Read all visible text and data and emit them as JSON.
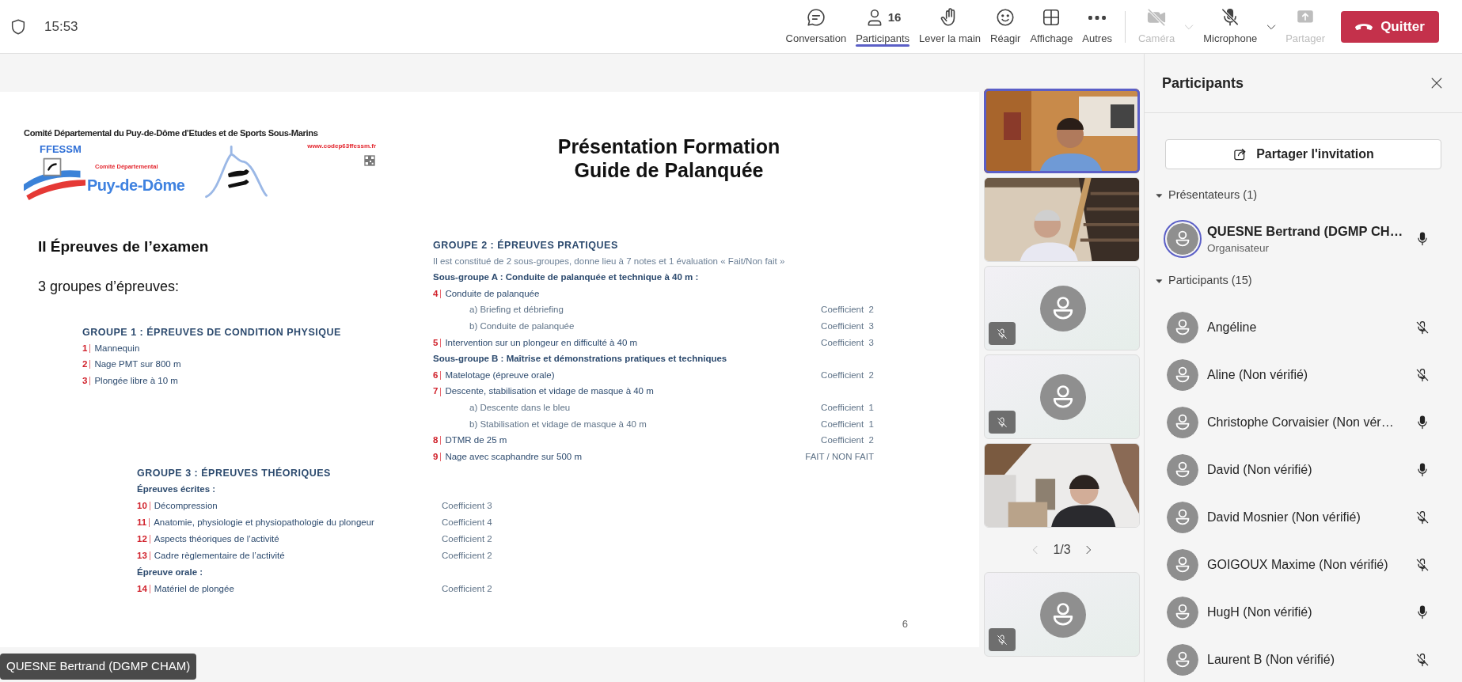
{
  "top_bar": {
    "time": "15:53"
  },
  "toolbar": [
    {
      "kind": "chat",
      "label": "Conversation",
      "selected": false,
      "disabled": false,
      "has_menu": false
    },
    {
      "kind": "people",
      "label": "Participants",
      "count": "16",
      "selected": true,
      "disabled": false,
      "has_menu": false
    },
    {
      "kind": "hand",
      "label": "Lever la main",
      "selected": false,
      "disabled": false,
      "has_menu": false
    },
    {
      "kind": "emoji",
      "label": "Réagir",
      "selected": false,
      "disabled": false,
      "has_menu": false
    },
    {
      "kind": "grid",
      "label": "Affichage",
      "selected": false,
      "disabled": false,
      "has_menu": false
    },
    {
      "kind": "more",
      "label": "Autres",
      "selected": false,
      "disabled": false,
      "has_menu": false
    },
    {
      "kind": "camera",
      "label": "Caméra",
      "selected": false,
      "disabled": true,
      "has_menu": true
    },
    {
      "kind": "mic",
      "label": "Microphone",
      "selected": false,
      "disabled": false,
      "has_menu": true
    },
    {
      "kind": "share",
      "label": "Partager",
      "selected": false,
      "disabled": true,
      "has_menu": false
    }
  ],
  "leave_button": {
    "label": "Quitter"
  },
  "slide": {
    "logo": {
      "header": "Comité Départemental du Puy-de-Dôme d’Etudes et de Sports Sous-Marins",
      "federation": "FFESSM",
      "url": "www.codep63ffessm.fr",
      "committee": "Comité Départemental",
      "department": "Puy-de-Dôme"
    },
    "title_lines": [
      "Présentation Formation",
      "Guide de Palanquée"
    ],
    "heading": "II Épreuves de l’examen",
    "subheading": "3 groupes d’épreuves:",
    "groups": [
      {
        "title": "GROUPE 1 : ÉPREUVES DE CONDITION PHYSIQUE",
        "rows": [
          {
            "kind": "item",
            "number": "1",
            "label": "Mannequin"
          },
          {
            "kind": "item",
            "number": "2",
            "label": "Nage PMT sur 800 m"
          },
          {
            "kind": "item",
            "number": "3",
            "label": "Plongée libre à 10 m"
          }
        ]
      },
      {
        "title": "GROUPE 2 : ÉPREUVES PRATIQUES",
        "rows": [
          {
            "kind": "note",
            "label": "Il est constitué de 2 sous-groupes, donne lieu à 7 notes et 1 évaluation « Fait/Non fait »"
          },
          {
            "kind": "subgroup",
            "label": "Sous-groupe A : Conduite de palanquée et technique à 40 m :"
          },
          {
            "kind": "item",
            "number": "4",
            "label": "Conduite de palanquée"
          },
          {
            "kind": "subitem",
            "label": "a) Briefing et débriefing",
            "coefficient": "Coefficient  2"
          },
          {
            "kind": "subitem",
            "label": "b) Conduite de palanquée",
            "coefficient": "Coefficient  3"
          },
          {
            "kind": "item",
            "number": "5",
            "label": "Intervention sur un plongeur en difficulté à 40 m",
            "coefficient": "Coefficient  3"
          },
          {
            "kind": "subgroup",
            "label": "Sous-groupe B : Maîtrise et démonstrations pratiques et techniques"
          },
          {
            "kind": "item",
            "number": "6",
            "label": "Matelotage (épreuve orale)",
            "coefficient": "Coefficient  2"
          },
          {
            "kind": "item",
            "number": "7",
            "label": "Descente, stabilisation et vidage de masque à 40 m"
          },
          {
            "kind": "subitem",
            "label": "a) Descente dans le bleu",
            "coefficient": "Coefficient  1"
          },
          {
            "kind": "subitem",
            "label": "b) Stabilisation et vidage de masque à 40 m",
            "coefficient": "Coefficient  1"
          },
          {
            "kind": "item",
            "number": "8",
            "label": "DTMR de 25 m",
            "coefficient": "Coefficient  2"
          },
          {
            "kind": "item",
            "number": "9",
            "label": "Nage avec scaphandre sur 500 m",
            "coefficient": "FAIT / NON FAIT"
          }
        ]
      },
      {
        "title": "GROUPE 3 : ÉPREUVES THÉORIQUES",
        "rows": [
          {
            "kind": "subgroup",
            "label": "Épreuves écrites :"
          },
          {
            "kind": "item",
            "number": "10",
            "label": "Décompression",
            "coefficient": "Coefficient 3"
          },
          {
            "kind": "item",
            "number": "11",
            "label": "Anatomie, physiologie et physiopathologie du plongeur",
            "coefficient": "Coefficient 4"
          },
          {
            "kind": "item",
            "number": "12",
            "label": "Aspects théoriques de l’activité",
            "coefficient": "Coefficient 2"
          },
          {
            "kind": "item",
            "number": "13",
            "label": "Cadre règlementaire de l’activité",
            "coefficient": "Coefficient 2"
          },
          {
            "kind": "subgroup",
            "label": "Épreuve orale :"
          },
          {
            "kind": "item",
            "number": "14",
            "label": "Matériel de plongée",
            "coefficient": "Coefficient 2"
          }
        ]
      }
    ],
    "page_number": "6"
  },
  "presenter_tag": "QUESNE Bertrand (DGMP CHAM)",
  "video_tiles": [
    {
      "kind": "video",
      "selected": true
    },
    {
      "kind": "video",
      "selected": false
    },
    {
      "kind": "avatar",
      "muted": true,
      "selected": false
    },
    {
      "kind": "avatar",
      "muted": true,
      "selected": false
    },
    {
      "kind": "video",
      "selected": false
    },
    {
      "kind": "avatar",
      "muted": true,
      "selected": false
    }
  ],
  "pager": {
    "text": "1/3"
  },
  "panel": {
    "title": "Participants",
    "share_button": "Partager l'invitation",
    "sections": [
      {
        "title": "Présentateurs (1)",
        "expanded": true,
        "people": [
          {
            "name": "QUESNE Bertrand (DGMP CH…",
            "role": "Organisateur",
            "muted": false,
            "speaking": true
          }
        ]
      },
      {
        "title": "Participants (15)",
        "expanded": true,
        "people": [
          {
            "name": "Angéline",
            "muted": true,
            "speaking": false
          },
          {
            "name": "Aline (Non vérifié)",
            "muted": true,
            "speaking": false
          },
          {
            "name": "Christophe Corvaisier (Non vér…",
            "muted": false,
            "speaking": false
          },
          {
            "name": "David (Non vérifié)",
            "muted": false,
            "speaking": false
          },
          {
            "name": "David Mosnier (Non vérifié)",
            "muted": true,
            "speaking": false
          },
          {
            "name": "GOIGOUX Maxime (Non vérifié)",
            "muted": true,
            "speaking": false
          },
          {
            "name": "HugH (Non vérifié)",
            "muted": false,
            "speaking": false
          },
          {
            "name": "Laurent B (Non vérifié)",
            "muted": true,
            "speaking": false
          }
        ]
      }
    ]
  }
}
